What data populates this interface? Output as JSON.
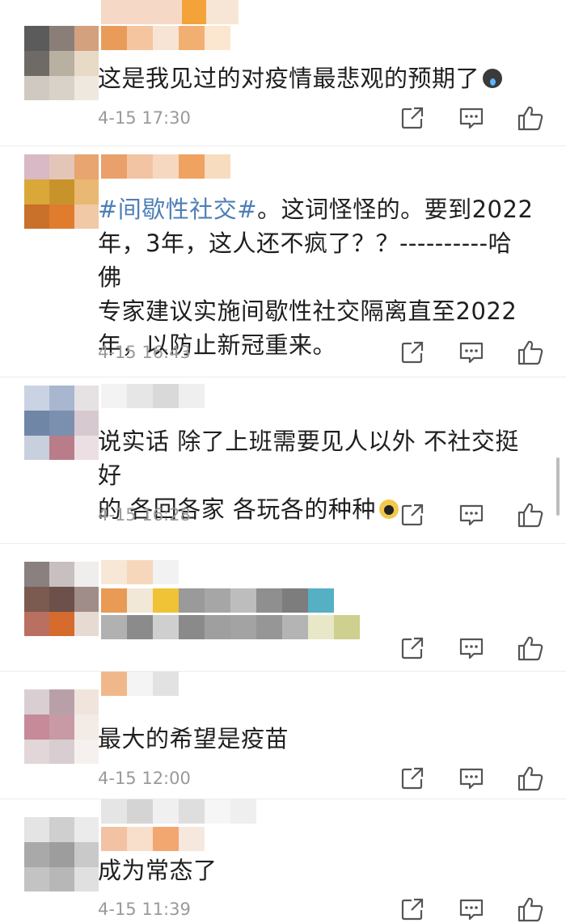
{
  "comments": [
    {
      "text": "这是我见过的对疫情最悲观的预期了",
      "emoji": "crying-face",
      "time": "4-15 17:30"
    },
    {
      "hashtag": "#间歇性社交#",
      "text_lines": [
        "。这词怪怪的。要到2022",
        "年，3年，这人还不疯了？？----------哈佛",
        "专家建议实施间歇性社交隔离直至2022",
        "年，以防止新冠重来。"
      ],
      "time": "4-15 16:43"
    },
    {
      "text_lines": [
        "说实话 除了上班需要见人以外 不社交挺好",
        "的 各回各家 各玩各的种种"
      ],
      "emoji": "shocked-face",
      "time": "4-15 16:28"
    },
    {
      "text": "",
      "time": ""
    },
    {
      "text": "最大的希望是疫苗",
      "time": "4-15 12:00"
    },
    {
      "text": "成为常态了",
      "time": "4-15 11:39"
    }
  ],
  "icons": {
    "share": "share-icon",
    "comment": "comment-icon",
    "like": "like-icon"
  },
  "colors": {
    "text": "#1f1f1f",
    "time": "#9a9a9a",
    "hashtag": "#4e7fb8",
    "icon": "#555555"
  }
}
